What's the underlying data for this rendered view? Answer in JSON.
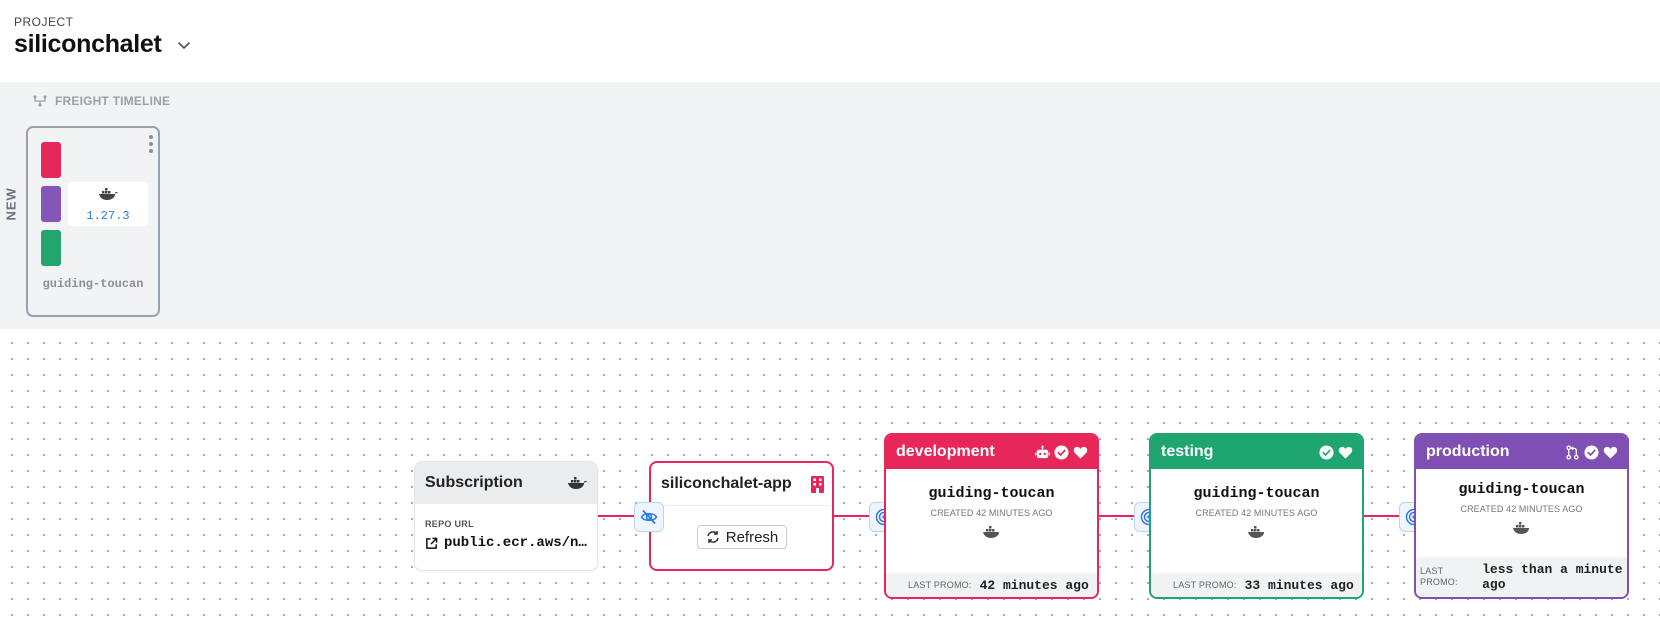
{
  "header": {
    "project_label": "PROJECT",
    "project_name": "siliconchalet"
  },
  "timeline": {
    "title": "FREIGHT TIMELINE",
    "new_label": "NEW",
    "freight": {
      "version": "1.27.3",
      "name": "guiding-toucan"
    }
  },
  "subscription": {
    "title": "Subscription",
    "repo_label": "REPO URL",
    "repo_url": "public.ecr.aws/n…"
  },
  "warehouse": {
    "name": "siliconchalet-app",
    "refresh_label": "Refresh"
  },
  "stages": [
    {
      "name": "development",
      "color": "#e7275a",
      "freight": "guiding-toucan",
      "created": "CREATED 42 MINUTES AGO",
      "last_promo_label": "LAST PROMO:",
      "last_promo": "42 minutes ago"
    },
    {
      "name": "testing",
      "color": "#1fa570",
      "freight": "guiding-toucan",
      "created": "CREATED 42 MINUTES AGO",
      "last_promo_label": "LAST PROMO:",
      "last_promo": "33 minutes ago"
    },
    {
      "name": "production",
      "color": "#7f4fb3",
      "freight": "guiding-toucan",
      "created": "CREATED 42 MINUTES AGO",
      "last_promo_label": "LAST PROMO:",
      "last_promo": "less than a minute ago"
    }
  ],
  "colors": {
    "edge": "#e7275a",
    "accent_blue": "#2d7be5"
  }
}
